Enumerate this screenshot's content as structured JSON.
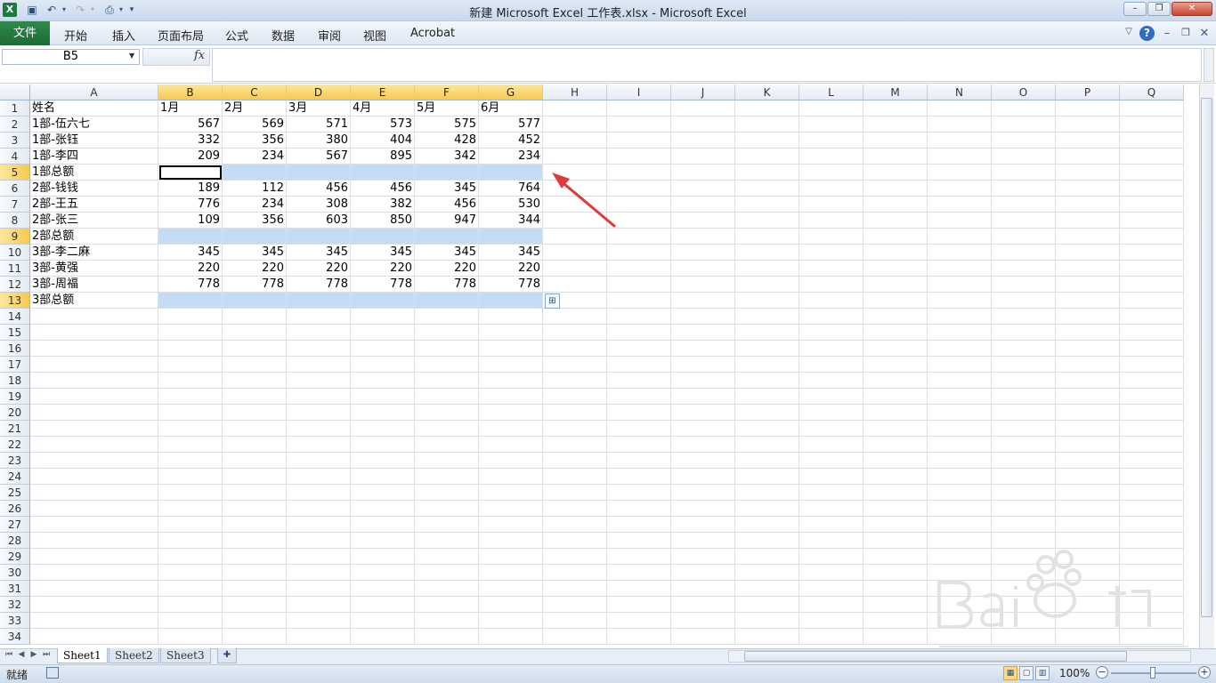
{
  "window": {
    "title": "新建 Microsoft Excel 工作表.xlsx  -  Microsoft Excel",
    "minimize_label": "–",
    "restore_label": "❐",
    "close_label": "✕"
  },
  "ribbon": {
    "file_tab": "文件",
    "tabs": [
      "开始",
      "插入",
      "页面布局",
      "公式",
      "数据",
      "审阅",
      "视图",
      "Acrobat"
    ]
  },
  "formula_bar": {
    "name_box": "B5",
    "fx_label": "fx",
    "value": ""
  },
  "grid": {
    "columns": [
      "A",
      "B",
      "C",
      "D",
      "E",
      "F",
      "G",
      "H",
      "I",
      "J",
      "K",
      "L",
      "M",
      "N",
      "O",
      "P",
      "Q"
    ],
    "selected_columns": [
      "B",
      "C",
      "D",
      "E",
      "F",
      "G"
    ],
    "row_count": 34,
    "selected_rows": [
      5,
      9,
      13
    ],
    "active_cell": "B5",
    "highlighted_ranges": [
      "B5:G5",
      "B9:G9",
      "B13:G13"
    ],
    "rows": [
      [
        "姓名",
        "1月",
        "2月",
        "3月",
        "4月",
        "5月",
        "6月"
      ],
      [
        "1部-伍六七",
        "567",
        "569",
        "571",
        "573",
        "575",
        "577"
      ],
      [
        "1部-张钰",
        "332",
        "356",
        "380",
        "404",
        "428",
        "452"
      ],
      [
        "1部-李四",
        "209",
        "234",
        "567",
        "895",
        "342",
        "234"
      ],
      [
        "1部总额",
        "",
        "",
        "",
        "",
        "",
        ""
      ],
      [
        "2部-钱钱",
        "189",
        "112",
        "456",
        "456",
        "345",
        "764"
      ],
      [
        "2部-王五",
        "776",
        "234",
        "308",
        "382",
        "456",
        "530"
      ],
      [
        "2部-张三",
        "109",
        "356",
        "603",
        "850",
        "947",
        "344"
      ],
      [
        "2部总额",
        "",
        "",
        "",
        "",
        "",
        ""
      ],
      [
        "3部-李二麻",
        "345",
        "345",
        "345",
        "345",
        "345",
        "345"
      ],
      [
        "3部-黄强",
        "220",
        "220",
        "220",
        "220",
        "220",
        "220"
      ],
      [
        "3部-周福",
        "778",
        "778",
        "778",
        "778",
        "778",
        "778"
      ],
      [
        "3部总额",
        "",
        "",
        "",
        "",
        "",
        ""
      ]
    ]
  },
  "sheets": [
    "Sheet1",
    "Sheet2",
    "Sheet3"
  ],
  "active_sheet": "Sheet1",
  "status": {
    "ready": "就绪",
    "zoom": "100%",
    "zoom_minus": "−",
    "zoom_plus": "+"
  },
  "colors": {
    "accent_green": "#1e6b35",
    "selection_fill": "#c5dcf5",
    "header_selected": "#f7c94f",
    "annotation_arrow": "#e03a3a"
  }
}
